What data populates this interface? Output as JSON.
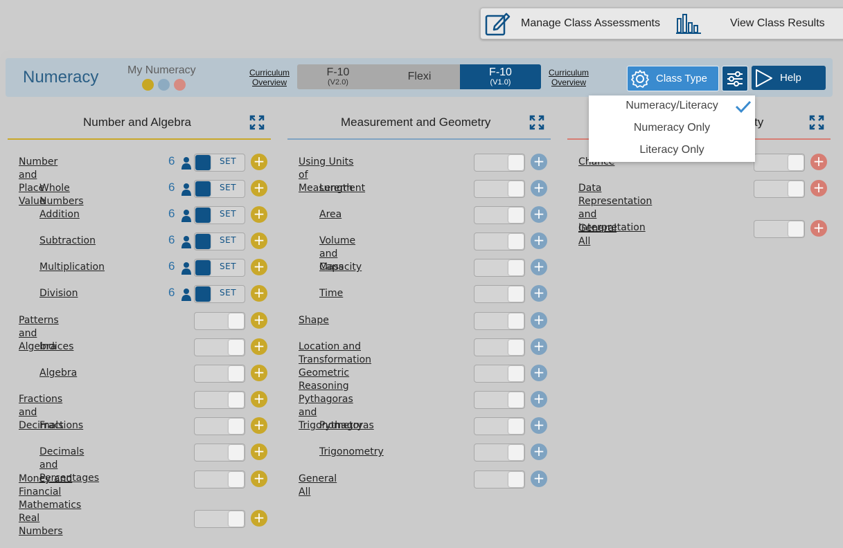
{
  "top_actions": {
    "manage_label": "Manage Class Assessments",
    "results_label": "View Class Results"
  },
  "header": {
    "brand": "Numeracy",
    "my_numeracy": "My Numeracy",
    "curriculum_overview_1": [
      "Curriculum",
      "Overview"
    ],
    "curriculum_overview_2": [
      "Curriculum",
      "Overview"
    ],
    "segments": [
      {
        "label": "F-10",
        "sub": "(V2.0)"
      },
      {
        "label": "Flexi",
        "sub": ""
      },
      {
        "label": "F-10",
        "sub": "(V1.0)",
        "selected": true
      }
    ],
    "class_type_label": "Class Type",
    "help_label": "Help"
  },
  "dropdown": {
    "items": [
      "Numeracy/Literacy",
      "Numeracy Only",
      "Literacy Only"
    ],
    "selected": "Numeracy/Literacy"
  },
  "colors": {
    "accent": "#0f5286",
    "yellow": "#c9a82a",
    "blue": "#7fa3c1",
    "red": "#d77d73"
  },
  "columns": [
    {
      "title": "Number and Algebra",
      "accent": "yellow",
      "rows": [
        {
          "name": "Number and Place Value",
          "indent": false,
          "on": true,
          "count": "6"
        },
        {
          "name": "Whole Numbers",
          "indent": true,
          "on": true,
          "count": "6"
        },
        {
          "name": "Addition",
          "indent": true,
          "on": true,
          "count": "6"
        },
        {
          "name": "Subtraction",
          "indent": true,
          "on": true,
          "count": "6"
        },
        {
          "name": "Multiplication",
          "indent": true,
          "on": true,
          "count": "6"
        },
        {
          "name": "Division",
          "indent": true,
          "on": true,
          "count": "6"
        },
        {
          "name": "Patterns and Algebra",
          "indent": false,
          "on": false
        },
        {
          "name": "Indices",
          "indent": true,
          "on": false
        },
        {
          "name": "Algebra",
          "indent": true,
          "on": false
        },
        {
          "name": "Fractions and Decimals",
          "indent": false,
          "on": false
        },
        {
          "name": "Fractions",
          "indent": true,
          "on": false
        },
        {
          "name": "Decimals and Percentages",
          "indent": true,
          "on": false
        },
        {
          "name": [
            "Money and Financial",
            "Mathematics"
          ],
          "indent": false,
          "on": false
        },
        {
          "name": "Real Numbers",
          "indent": false,
          "on": false
        }
      ],
      "set_label": "SET"
    },
    {
      "title": "Measurement and Geometry",
      "accent": "blue",
      "rows": [
        {
          "name": "Using Units of Measurement",
          "indent": false
        },
        {
          "name": "Length",
          "indent": true
        },
        {
          "name": "Area",
          "indent": true
        },
        {
          "name": "Volume and Capacity",
          "indent": true
        },
        {
          "name": "Mass",
          "indent": true
        },
        {
          "name": "Time",
          "indent": true
        },
        {
          "name": "Shape",
          "indent": false
        },
        {
          "name": "Location and Transformation",
          "indent": false
        },
        {
          "name": "Geometric Reasoning",
          "indent": false
        },
        {
          "name": "Pythagoras and Trigonometry",
          "indent": false
        },
        {
          "name": "Pythagoras",
          "indent": true
        },
        {
          "name": "Trigonometry",
          "indent": true
        },
        {
          "name": "General All",
          "indent": false
        }
      ]
    },
    {
      "title": "ty",
      "accent": "red",
      "rows": [
        {
          "name": "Chance",
          "indent": false
        },
        {
          "name": [
            "Data Representation and",
            "Interpretation"
          ],
          "indent": false
        },
        {
          "name": "General All",
          "indent": false
        }
      ]
    }
  ]
}
